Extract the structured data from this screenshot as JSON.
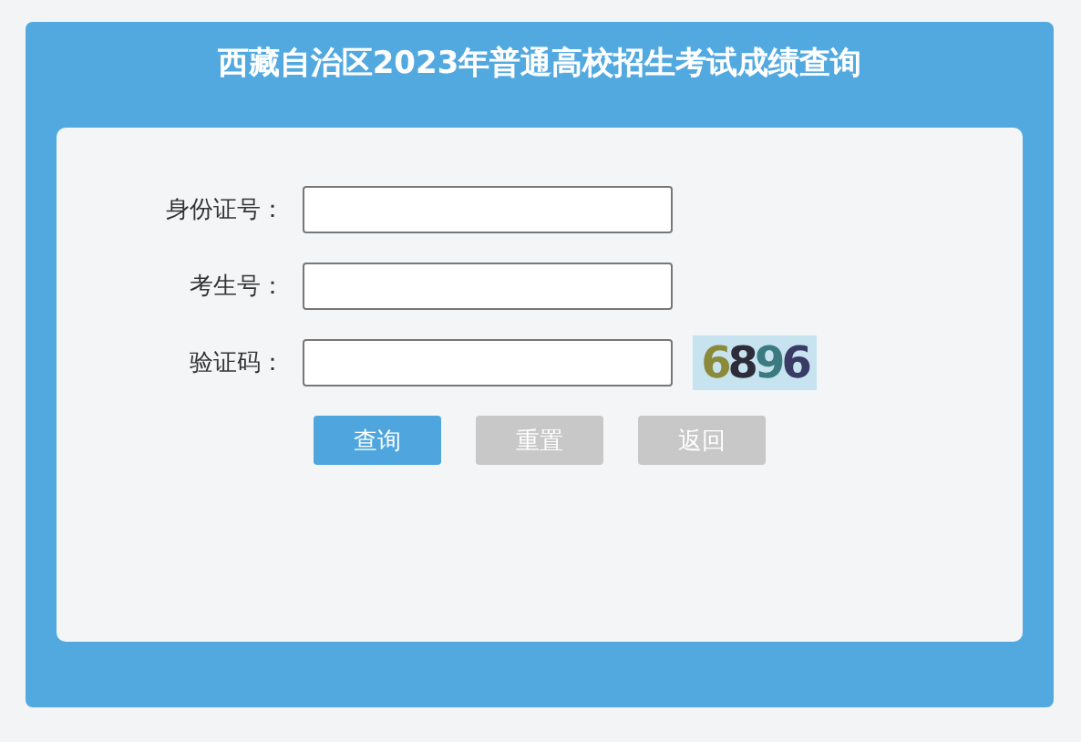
{
  "title": "西藏自治区2023年普通高校招生考试成绩查询",
  "fields": [
    {
      "label": "身份证号：",
      "kind": "text"
    },
    {
      "label": "考生号：",
      "kind": "text"
    },
    {
      "label": "验证码：",
      "kind": "captcha",
      "captcha": "6896"
    }
  ],
  "buttons": [
    {
      "label": "查询",
      "kind": "primary"
    },
    {
      "label": "重置",
      "kind": "secondary"
    },
    {
      "label": "返回",
      "kind": "secondary"
    }
  ]
}
